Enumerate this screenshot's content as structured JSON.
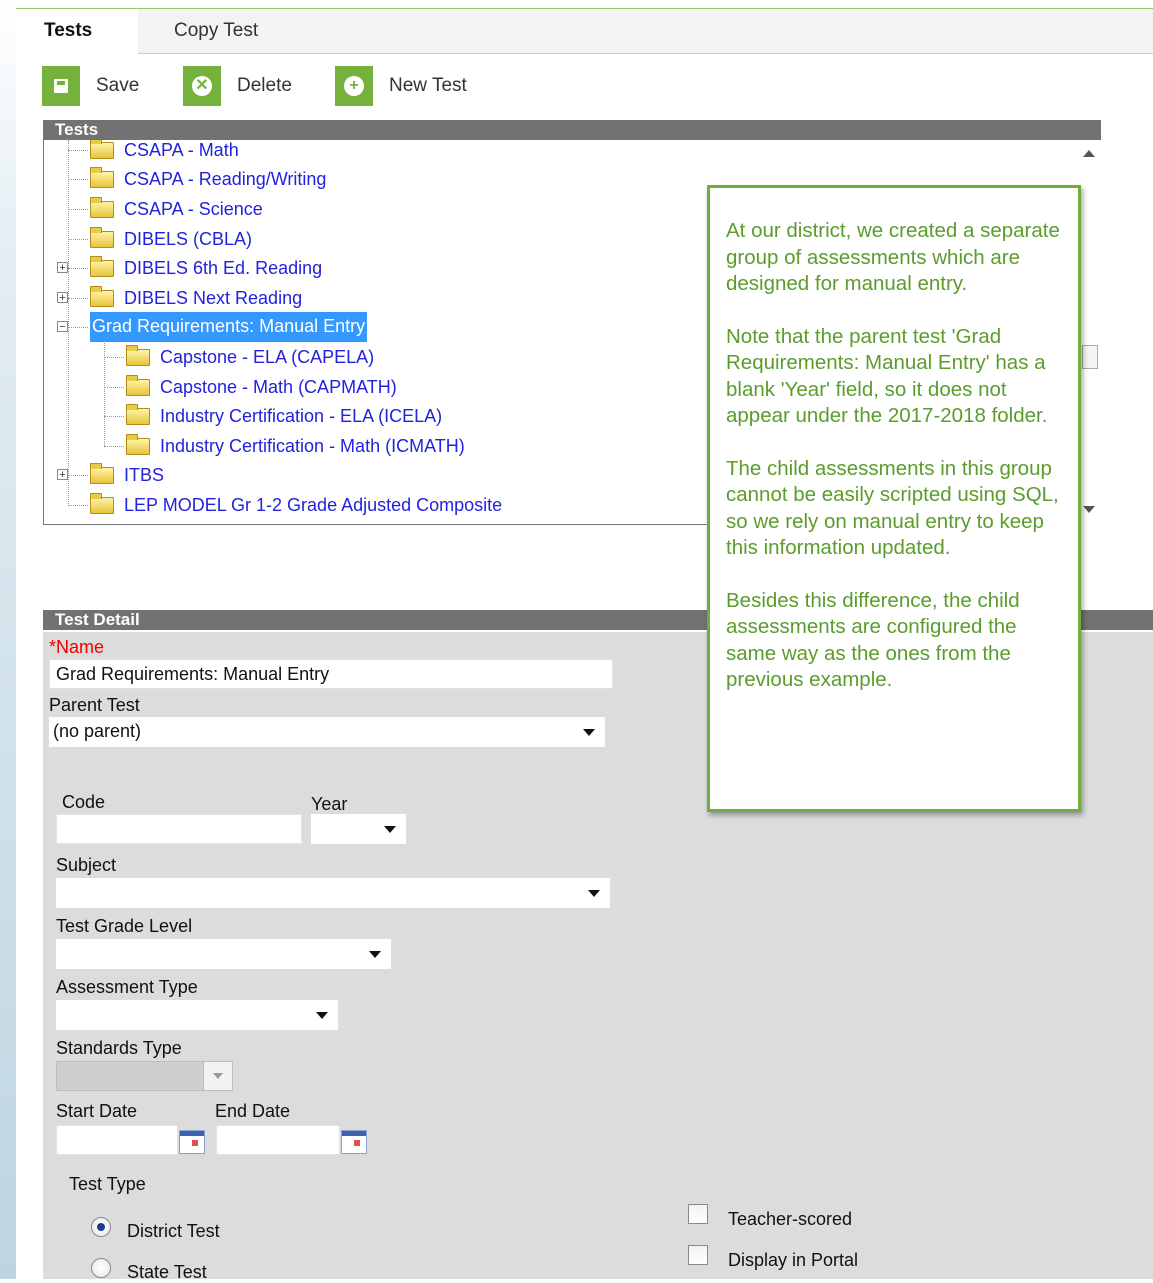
{
  "tabs": [
    {
      "label": "Tests",
      "active": true
    },
    {
      "label": "Copy Test",
      "active": false
    }
  ],
  "toolbar": {
    "save_label": "Save",
    "delete_label": "Delete",
    "new_label": "New Test"
  },
  "tree": {
    "header": "Tests",
    "items": [
      {
        "label": "CSAPA - Math"
      },
      {
        "label": "CSAPA - Reading/Writing"
      },
      {
        "label": "CSAPA - Science"
      },
      {
        "label": "DIBELS (CBLA)"
      },
      {
        "label": "DIBELS 6th Ed. Reading"
      },
      {
        "label": "DIBELS Next Reading"
      },
      {
        "label": "Grad Requirements: Manual Entry",
        "selected": true
      },
      {
        "label": "Capstone - ELA (CAPELA)"
      },
      {
        "label": "Capstone - Math (CAPMATH)"
      },
      {
        "label": "Industry Certification - ELA (ICELA)"
      },
      {
        "label": "Industry Certification - Math (ICMATH)"
      },
      {
        "label": "ITBS"
      },
      {
        "label": "LEP MODEL Gr 1-2 Grade Adjusted Composite"
      }
    ]
  },
  "detail": {
    "header": "Test Detail",
    "name_label": "Name",
    "name_value": "Grad Requirements: Manual Entry",
    "parent_label": "Parent Test",
    "parent_value": "(no parent)",
    "code_label": "Code",
    "year_label": "Year",
    "subject_label": "Subject",
    "grade_label": "Test Grade Level",
    "assessment_label": "Assessment Type",
    "standards_label": "Standards Type",
    "start_label": "Start Date",
    "end_label": "End Date",
    "testtype_label": "Test Type",
    "district_label": "District Test",
    "state_label": "State Test",
    "teacher_label": "Teacher-scored",
    "portal_label": "Display in Portal"
  },
  "callout": {
    "p1": "At our district, we created a separate group of assessments which are designed for manual entry.",
    "p2": "Note that the parent test 'Grad Requirements: Manual Entry' has a blank 'Year' field, so it does not appear under the 2017-2018 folder.",
    "p3": "The child assessments in this group cannot be easily scripted using SQL, so we rely on manual entry to keep this information updated.",
    "p4": "Besides this difference, the child assessments are configured the same way as the ones from the previous example."
  },
  "colors": {
    "accent_green": "#74b23b",
    "callout_text": "#5b9c2c",
    "link_blue": "#2222dd",
    "selection_blue": "#3399ff"
  }
}
